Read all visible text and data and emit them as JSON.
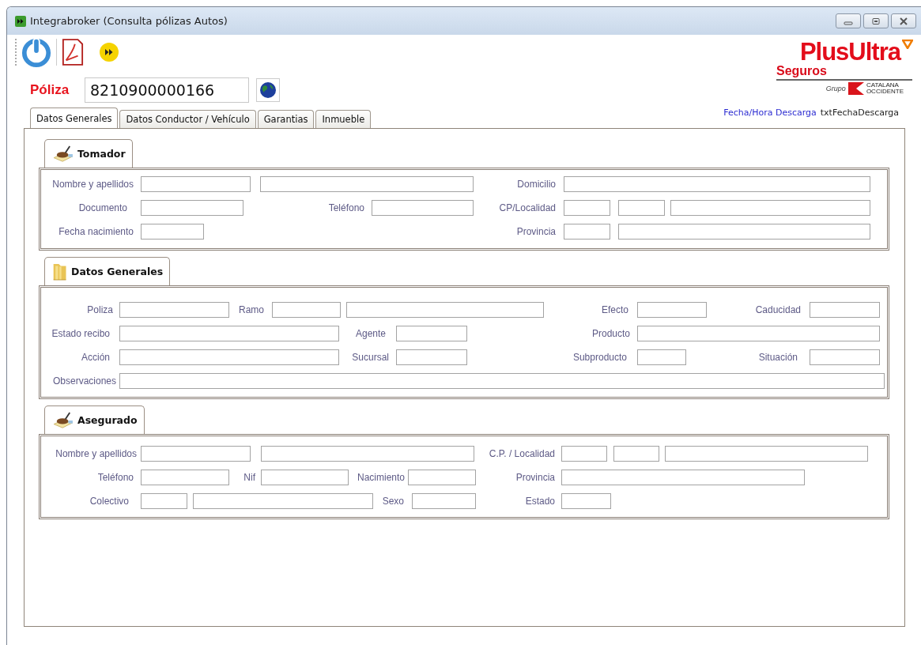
{
  "window": {
    "title": "Integrabroker (Consulta pólizas Autos)"
  },
  "policy": {
    "label": "Póliza",
    "value": "8210900000166"
  },
  "logo": {
    "brand": "PlusUltra",
    "sub": "Seguros",
    "group": "Grupo",
    "partner_1": "CATALANA",
    "partner_2": "OCCIDENTE"
  },
  "download": {
    "label": "Fecha/Hora Descarga",
    "value": "txtFechaDescarga"
  },
  "tabs": [
    {
      "label": "Datos Generales",
      "selected": true
    },
    {
      "label": "Datos Conductor / Vehículo",
      "selected": false
    },
    {
      "label": "Garantias",
      "selected": false
    },
    {
      "label": "Inmueble",
      "selected": false
    }
  ],
  "sections": [
    {
      "title": "Tomador",
      "kind": "person",
      "rows": [
        [
          {
            "label": "Nombre y apellidos"
          },
          null,
          {
            "label": "Domicilio"
          }
        ],
        [
          {
            "label": "Documento"
          },
          {
            "label": "Teléfono"
          },
          {
            "label": "CP/Localidad"
          }
        ],
        [
          {
            "label": "Fecha nacimiento"
          },
          null,
          {
            "label": "Provincia"
          }
        ]
      ]
    },
    {
      "title": "Datos Generales",
      "kind": "folder",
      "rows": [
        [
          {
            "label": "Poliza"
          },
          {
            "label": "Ramo"
          },
          {
            "label": "Efecto"
          },
          {
            "label": "Caducidad"
          }
        ],
        [
          {
            "label": "Estado recibo"
          },
          {
            "label": "Agente"
          },
          {
            "label": "Producto"
          },
          null
        ],
        [
          {
            "label": "Acción"
          },
          {
            "label": "Sucursal"
          },
          {
            "label": "Subproducto"
          },
          {
            "label": "Situación"
          }
        ],
        [
          {
            "label": "Observaciones"
          }
        ]
      ]
    },
    {
      "title": "Asegurado",
      "kind": "person",
      "rows": [
        [
          {
            "label": "Nombre y apellidos"
          },
          null,
          null,
          {
            "label": "C.P. / Localidad"
          }
        ],
        [
          {
            "label": "Teléfono"
          },
          {
            "label": "Nif"
          },
          {
            "label": "Nacimiento"
          },
          {
            "label": "Provincia"
          }
        ],
        [
          {
            "label": "Colectivo"
          },
          null,
          {
            "label": "Sexo"
          },
          {
            "label": "Estado"
          }
        ]
      ]
    }
  ]
}
